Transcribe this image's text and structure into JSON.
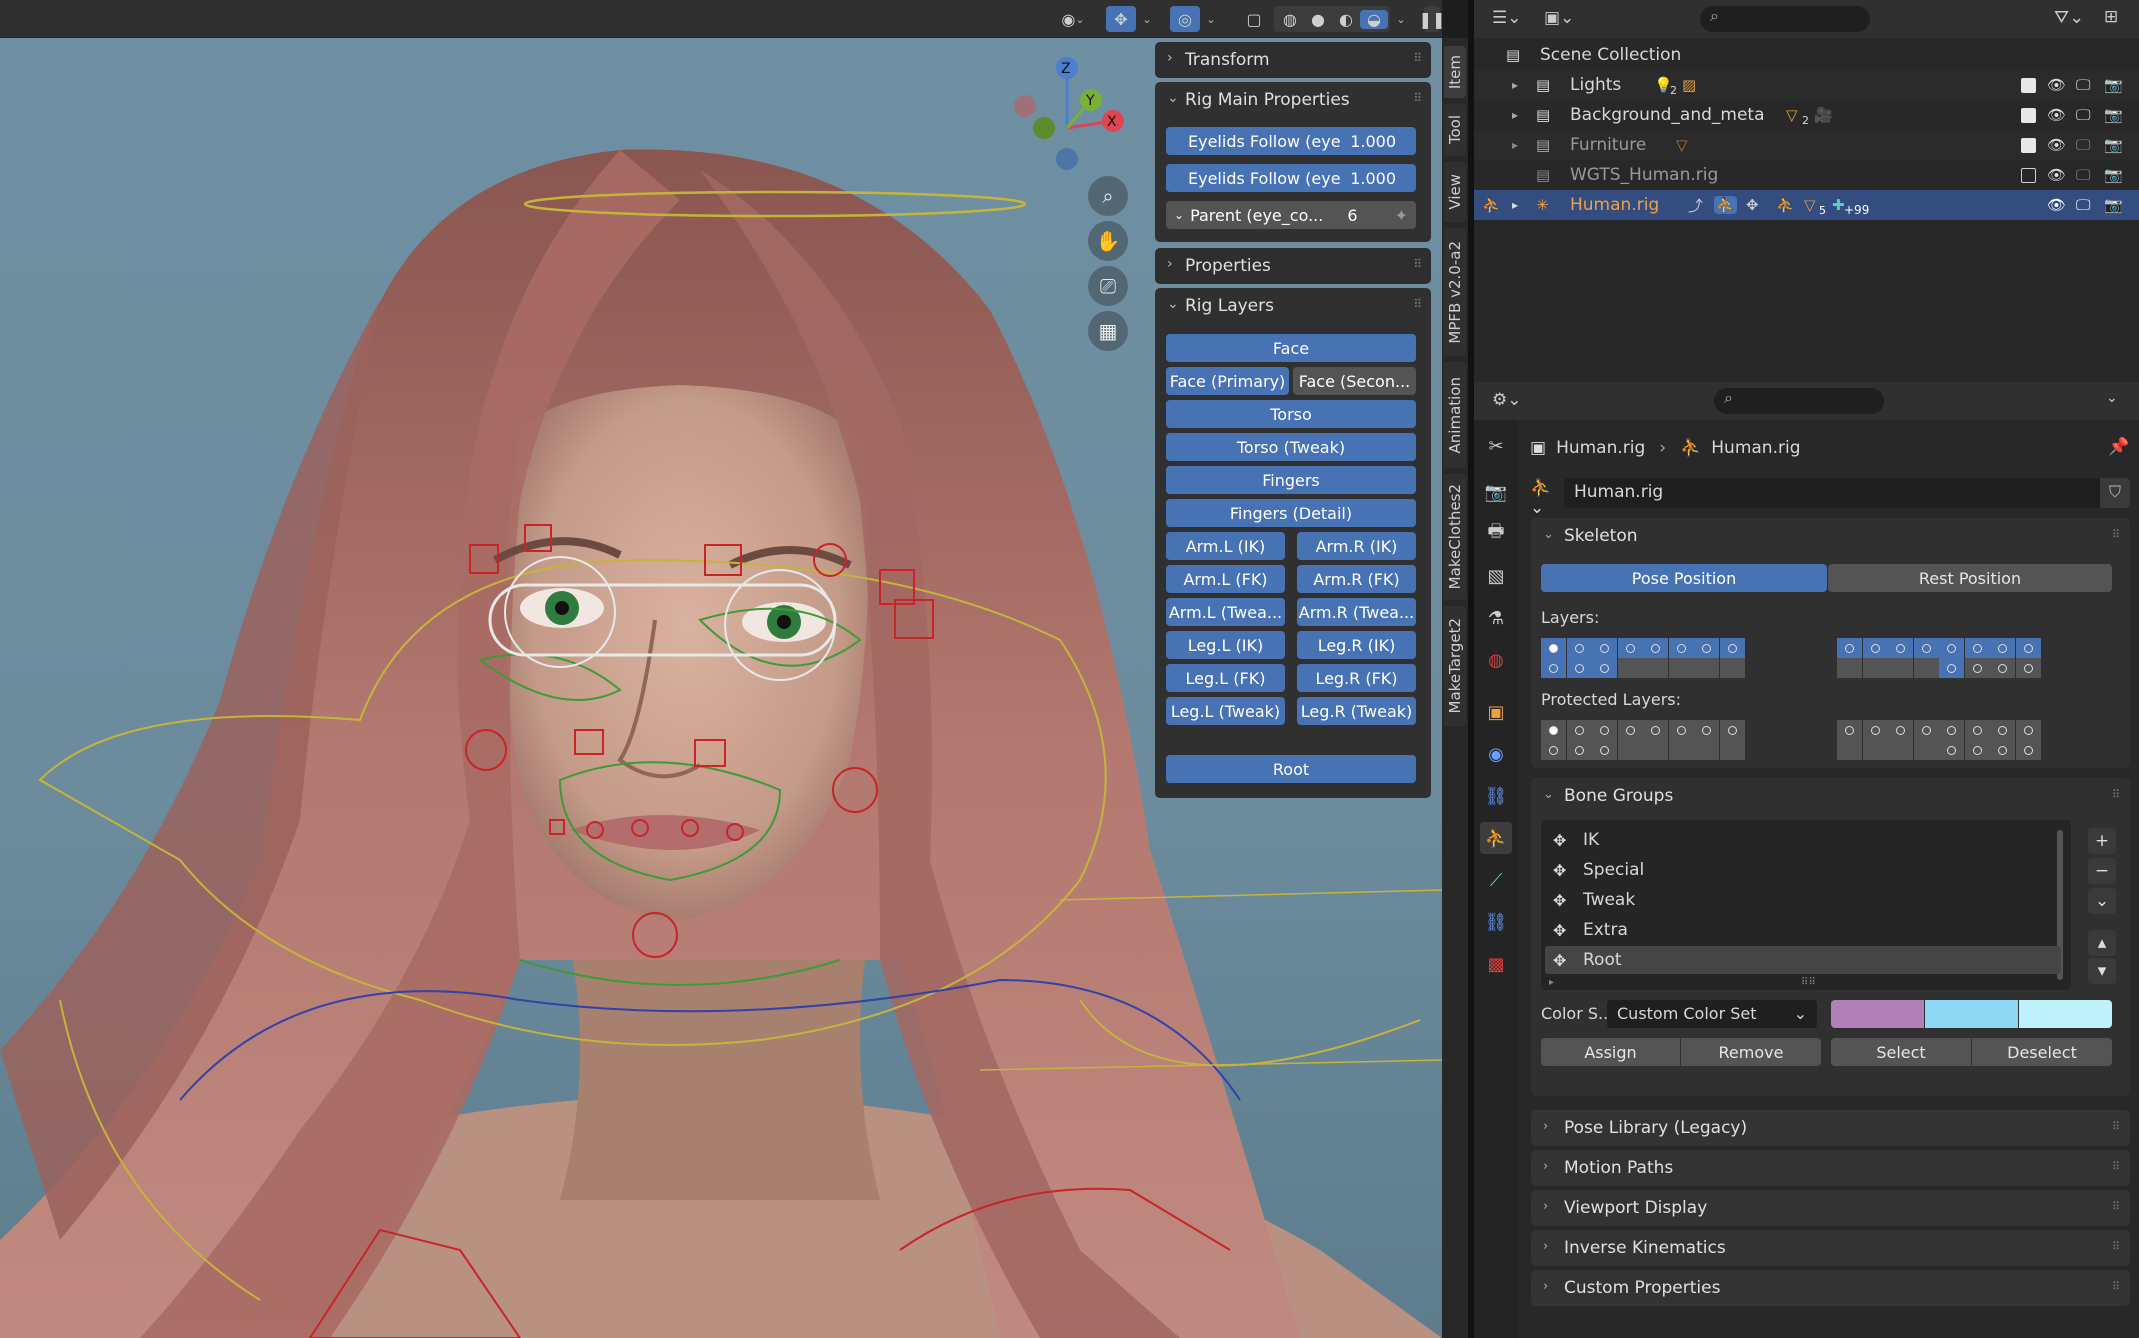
{
  "viewport": {
    "gizmo": {
      "z": "Z",
      "y": "Y",
      "x": "X"
    },
    "header_icons": [
      "eye-icon",
      "bone-icon",
      "overlay-icon",
      "xray-icon",
      "wireframe-icon",
      "solid-icon",
      "material-icon",
      "rendered-icon",
      "pause-icon"
    ]
  },
  "npanel": {
    "transform_label": "Transform",
    "rig_main_label": "Rig Main Properties",
    "eyelids_1": {
      "label": "Eyelids Follow (eye",
      "value": "1.000"
    },
    "eyelids_2": {
      "label": "Eyelids Follow (eye",
      "value": "1.000"
    },
    "parent": {
      "label": "Parent (eye_co...",
      "value": "6"
    },
    "properties_label": "Properties",
    "rig_layers_label": "Rig Layers",
    "layers": {
      "face": "Face",
      "face_primary": "Face (Primary)",
      "face_secondary": "Face (Secon...",
      "torso": "Torso",
      "torso_tweak": "Torso (Tweak)",
      "fingers": "Fingers",
      "fingers_detail": "Fingers (Detail)",
      "arm_l_ik": "Arm.L (IK)",
      "arm_r_ik": "Arm.R (IK)",
      "arm_l_fk": "Arm.L (FK)",
      "arm_r_fk": "Arm.R (FK)",
      "arm_l_tweak": "Arm.L (Twea...",
      "arm_r_tweak": "Arm.R (Twea...",
      "leg_l_ik": "Leg.L (IK)",
      "leg_r_ik": "Leg.R (IK)",
      "leg_l_fk": "Leg.L (FK)",
      "leg_r_fk": "Leg.R (FK)",
      "leg_l_tweak": "Leg.L (Tweak)",
      "leg_r_tweak": "Leg.R (Tweak)",
      "root": "Root"
    },
    "tabs": [
      "Item",
      "Tool",
      "View",
      "MPFB v2.0-a2",
      "Animation",
      "MakeClothes2",
      "MakeTarget2"
    ]
  },
  "outliner": {
    "scene_collection": "Scene Collection",
    "rows": [
      {
        "name": "Lights",
        "badge": "2"
      },
      {
        "name": "Background_and_meta",
        "badge": "2"
      },
      {
        "name": "Furniture",
        "badge": ""
      },
      {
        "name": "WGTS_Human.rig",
        "badge": ""
      },
      {
        "name": "Human.rig",
        "badge": "5",
        "extra": "+99"
      }
    ]
  },
  "properties": {
    "breadcrumb": {
      "object": "Human.rig",
      "data": "Human.rig"
    },
    "data_name": "Human.rig",
    "skeleton_label": "Skeleton",
    "pose_position": "Pose Position",
    "rest_position": "Rest Position",
    "layers_label": "Layers:",
    "protected_layers_label": "Protected Layers:",
    "bone_groups_label": "Bone Groups",
    "bone_groups": [
      "IK",
      "Special",
      "Tweak",
      "Extra",
      "Root"
    ],
    "color_set_label": "Color S...",
    "color_set_value": "Custom Color Set",
    "color_swatches": [
      "#b27fb8",
      "#8fd8f3",
      "#bff1fa"
    ],
    "assign": "Assign",
    "remove": "Remove",
    "select": "Select",
    "deselect": "Deselect",
    "sections": [
      "Pose Library (Legacy)",
      "Motion Paths",
      "Viewport Display",
      "Inverse Kinematics",
      "Custom Properties"
    ]
  }
}
